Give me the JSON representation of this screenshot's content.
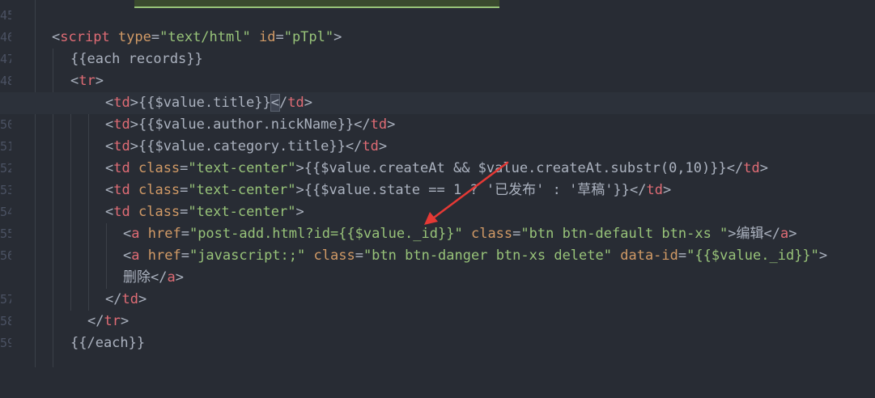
{
  "gutter": {
    "numbers": [
      "45",
      "46",
      "47",
      "48",
      "49",
      "50",
      "51",
      "52",
      "53",
      "54",
      "55",
      "56",
      "57",
      "58",
      "59"
    ]
  },
  "code": {
    "line46": {
      "open": "<",
      "tag": "script",
      "attr1": "type",
      "eq1": "=",
      "val1": "\"text/html\"",
      "attr2": "id",
      "eq2": "=",
      "val2": "\"pTpl\"",
      "close": ">"
    },
    "line47": {
      "text": "{{each records}}"
    },
    "line48": {
      "open": "<",
      "tag": "tr",
      "close": ">"
    },
    "line49": {
      "open": "<",
      "tag": "td",
      "close": ">",
      "text": "{{$value.title}}",
      "endOpen": "<",
      "endSlash": "/",
      "endTag": "td",
      "endClose": ">"
    },
    "line50": {
      "open": "<",
      "tag": "td",
      "close": ">",
      "text": "{{$value.author.nickName}}",
      "endOpen": "</",
      "endTag": "td",
      "endClose": ">"
    },
    "line51": {
      "open": "<",
      "tag": "td",
      "close": ">",
      "text": "{{$value.category.title}}",
      "endOpen": "</",
      "endTag": "td",
      "endClose": ">"
    },
    "line52": {
      "open": "<",
      "tag": "td",
      "attr": "class",
      "eq": "=",
      "val": "\"text-center\"",
      "close": ">",
      "text": "{{$value.createAt && $value.createAt.substr(0,10)}}",
      "endOpen": "</",
      "endTag": "td",
      "endClose": ">"
    },
    "line53": {
      "open": "<",
      "tag": "td",
      "attr": "class",
      "eq": "=",
      "val": "\"text-center\"",
      "close": ">",
      "text": "{{$value.state == 1 ? '已发布' : '草稿'}}",
      "endOpen": "</",
      "endTag": "td",
      "endClose": ">"
    },
    "line54": {
      "open": "<",
      "tag": "td",
      "attr": "class",
      "eq": "=",
      "val": "\"text-center\"",
      "close": ">"
    },
    "line55": {
      "open": "<",
      "tag": "a",
      "attr1": "href",
      "eq1": "=",
      "val1": "\"post-add.html?id={{$value._id}}\"",
      "attr2": "class",
      "eq2": "=",
      "val2": "\"btn btn-default btn-xs \"",
      "close": ">",
      "text": "编辑",
      "endOpen": "</",
      "endTag": "a",
      "endClose": ">"
    },
    "line56": {
      "open": "<",
      "tag": "a",
      "attr1": "href",
      "eq1": "=",
      "val1": "\"javascript:;\"",
      "attr2": "class",
      "eq2": "=",
      "val2": "\"btn btn-danger btn-xs delete\"",
      "attr3": "data-id",
      "eq3": "=",
      "val3": "\"{{$value._id}}\"",
      "close": ">"
    },
    "line56b": {
      "text": "删除",
      "endOpen": "</",
      "endTag": "a",
      "endClose": ">"
    },
    "line57": {
      "endOpen": "</",
      "endTag": "td",
      "endClose": ">"
    },
    "line58": {
      "endOpen": "</",
      "endTag": "tr",
      "endClose": ">"
    },
    "line59": {
      "text": "{{/each}}"
    }
  },
  "colors": {
    "background": "#282c34",
    "tag": "#e06c75",
    "attribute": "#d19a66",
    "string": "#98c379",
    "text": "#abb2bf",
    "annotation_arrow": "#e53935"
  }
}
